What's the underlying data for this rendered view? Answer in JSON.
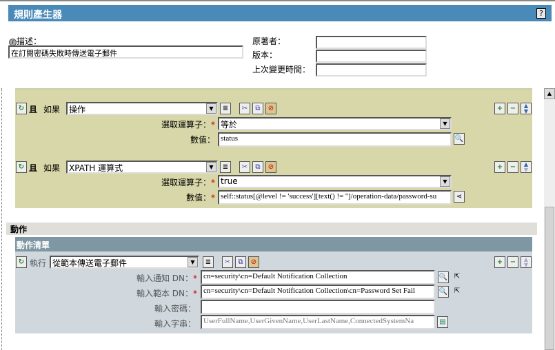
{
  "header": {
    "title": "規則產生器",
    "help": "?"
  },
  "meta": {
    "description_label": "描述：",
    "description_value": "在訂閱密碼失敗時傳送電子郵件",
    "author_label": "原著者：",
    "author_value": "",
    "version_label": "版本：",
    "version_value": "",
    "modified_label": "上次變更時間：",
    "modified_value": ""
  },
  "conditions": [
    {
      "and": "且",
      "if": "如果",
      "type": "操作",
      "operator_label": "選取運算子：",
      "operator": "等於",
      "value_label": "數值：",
      "value": "status"
    },
    {
      "and": "且",
      "if": "如果",
      "type": "XPATH 運算式",
      "operator_label": "選取運算子：",
      "operator": "true",
      "value_label": "數值：",
      "value": "self::status[@level != 'success'][text() != '']/operation-data/password-su"
    }
  ],
  "actions": {
    "section_title": "動作",
    "list_title": "動作清單",
    "do_label": "執行",
    "action": "從範本傳送電子郵件",
    "fields": [
      {
        "label": "輸入通知 DN：",
        "value": "cn=security\\cn=Default Notification Collection"
      },
      {
        "label": "輸入範本 DN：",
        "value": "cn=security\\cn=Default Notification Collection\\cn=Password Set Fail"
      },
      {
        "label": "輸入密碼：",
        "value": ""
      },
      {
        "label": "輸入字串：",
        "value": "UserFullName,UserGivenName,UserLastName,ConnectedSystemNa"
      }
    ]
  },
  "required_mark": "*"
}
